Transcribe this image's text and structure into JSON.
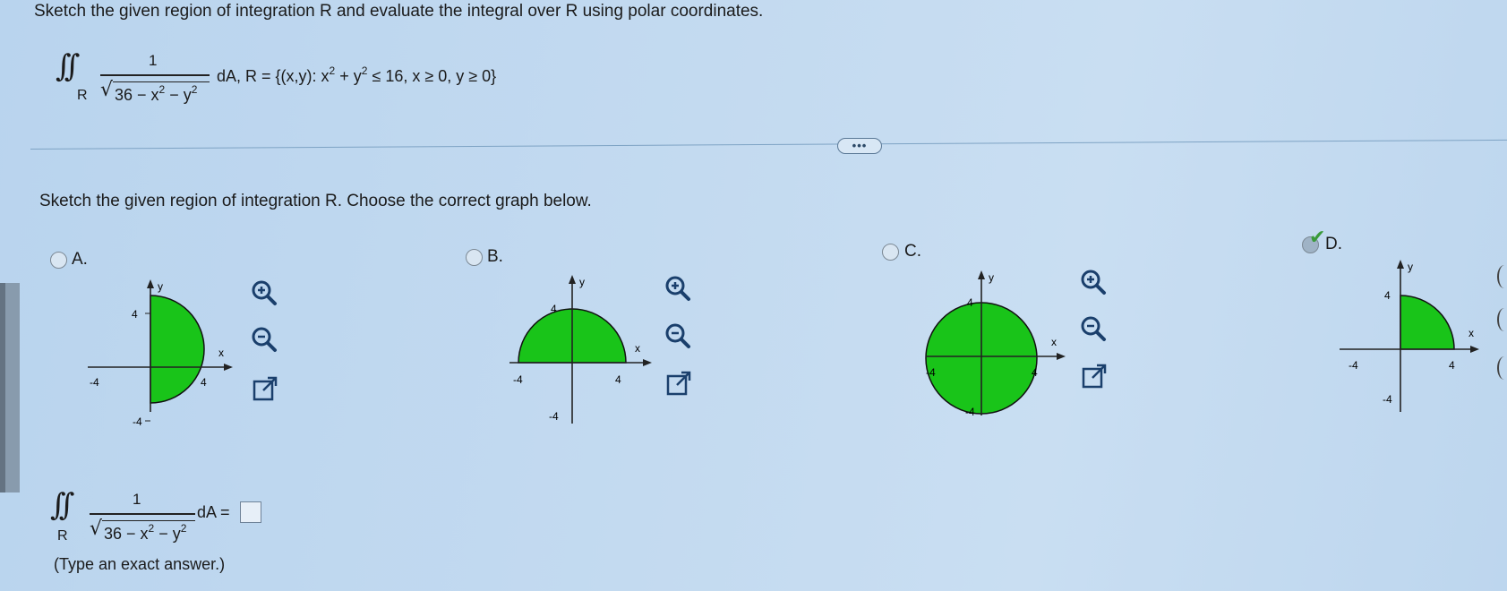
{
  "question": {
    "prompt": "Sketch the given region of integration R and evaluate the integral over R using polar coordinates.",
    "integral_symbol": "∫∫",
    "region_subscript": "R",
    "numerator": "1",
    "radicand": "36 − x",
    "radicand_exp1": "2",
    "radicand_mid": " − y",
    "radicand_exp2": "2",
    "suffix_da": "dA, R = {(x,y): x",
    "suffix_exp1": "2",
    "suffix_mid": " + y",
    "suffix_exp2": "2",
    "suffix_end": " ≤ 16, x ≥ 0, y ≥ 0}"
  },
  "more_button": {
    "label": "•••"
  },
  "part1": {
    "instruction": "Sketch the given region of integration R. Choose the correct graph below.",
    "options": [
      {
        "letter": "A.",
        "selected": false
      },
      {
        "letter": "B.",
        "selected": false
      },
      {
        "letter": "C.",
        "selected": false
      },
      {
        "letter": "D.",
        "selected": true
      }
    ]
  },
  "graphs": {
    "axis_x": "x",
    "axis_y": "y",
    "tick_pos": "4",
    "tick_neg": "-4",
    "fill_color": "#19c419"
  },
  "answer": {
    "integral_symbol": "∫∫",
    "region_subscript": "R",
    "numerator": "1",
    "radicand": "36 − x",
    "radicand_exp1": "2",
    "radicand_mid": " − y",
    "radicand_exp2": "2",
    "equals": "dA =",
    "note": "(Type an exact answer.)"
  }
}
